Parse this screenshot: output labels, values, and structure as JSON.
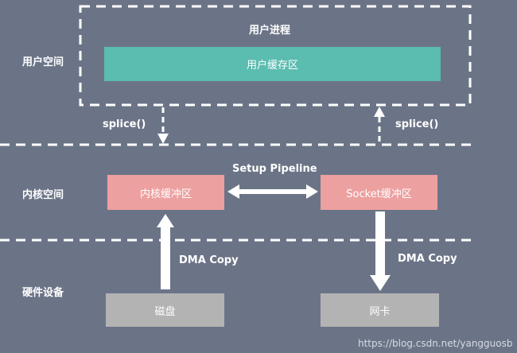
{
  "zones": {
    "user": "用户空间",
    "kernel": "内核空间",
    "hardware": "硬件设备"
  },
  "user_process_label": "用户进程",
  "boxes": {
    "user_buffer": "用户缓存区",
    "kernel_buffer": "内核缓冲区",
    "socket_buffer": "Socket缓冲区",
    "disk": "磁盘",
    "nic": "网卡"
  },
  "edges": {
    "splice_down": "splice()",
    "splice_up": "splice()",
    "pipeline": "Setup Pipeline",
    "dma_in": "DMA Copy",
    "dma_out": "DMA Copy"
  },
  "watermark": "https://blog.csdn.net/yangguosb",
  "colors": {
    "background": "#6b7487",
    "user_buffer": "#5bbcb0",
    "kernel_buffers": "#eda0a0",
    "devices": "#b3b3b3",
    "lines": "#ffffff"
  }
}
